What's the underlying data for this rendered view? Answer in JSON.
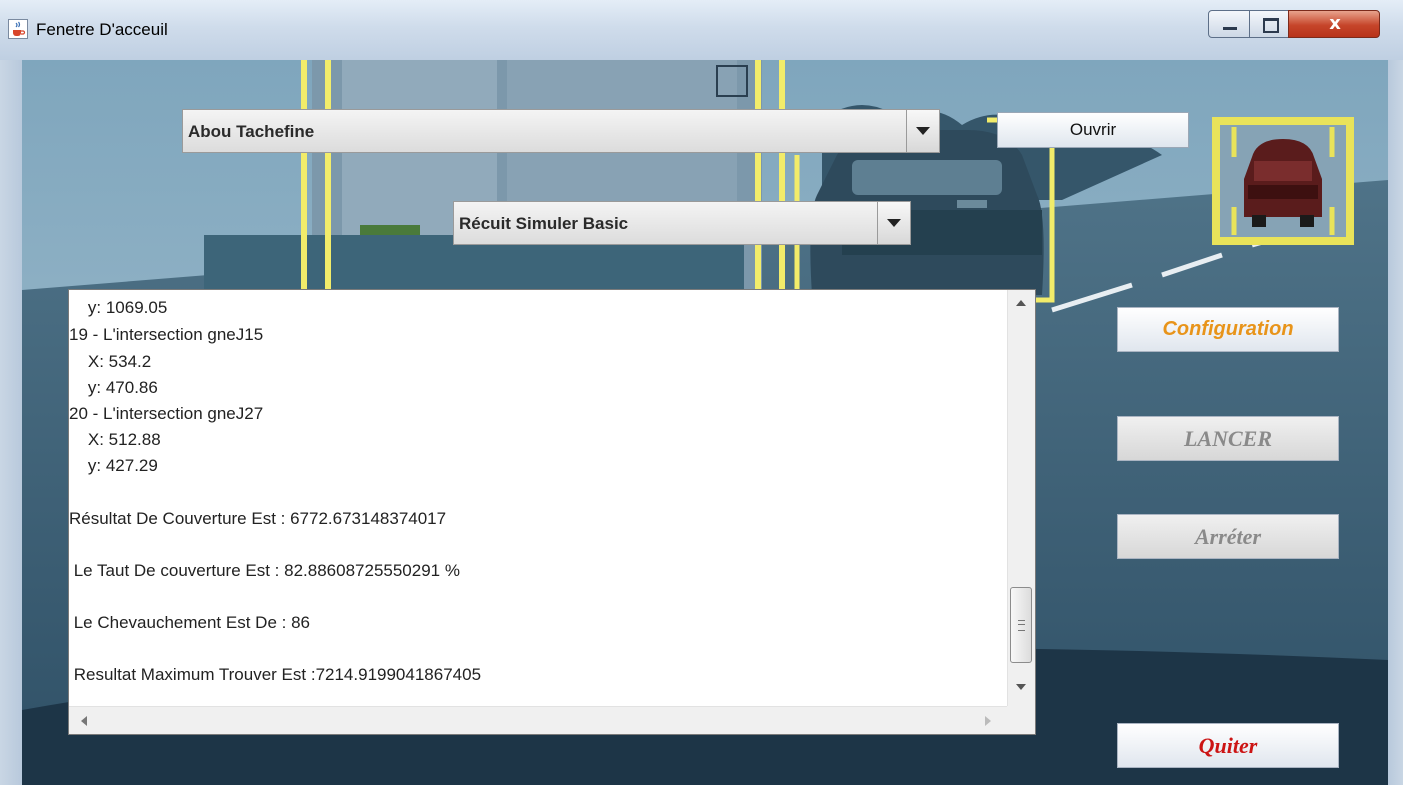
{
  "window": {
    "title": "Fenetre D'acceuil",
    "close_glyph": "x",
    "icon": "java-cup-icon"
  },
  "controls": {
    "city_select": {
      "value": "Abou Tachefine"
    },
    "algorithm_select": {
      "value": "Récuit Simuler Basic"
    },
    "open_label": "Ouvrir"
  },
  "side_buttons": {
    "configuration": "Configuration",
    "launch": "LANCER",
    "stop": "Arréter",
    "quit": "Quiter"
  },
  "output": {
    "lines": [
      "    y: 1069.05",
      "19 - L'intersection gneJ15",
      "    X: 534.2",
      "    y: 470.86",
      "20 - L'intersection gneJ27",
      "    X: 512.88",
      "    y: 427.29",
      "Résultat De Couverture Est : 6772.673148374017",
      " Le Taut De couverture Est : 82.88608725550291 %",
      " Le Chevauchement Est De : 86",
      " Resultat Maximum Trouver Est :7214.9199041867405"
    ],
    "scroll_position": 0.93
  },
  "colors": {
    "config_text": "#e8941a",
    "disabled_text": "#8a8a8a",
    "quit_text": "#cc1414",
    "highlight_yellow": "#f2ec6a"
  }
}
